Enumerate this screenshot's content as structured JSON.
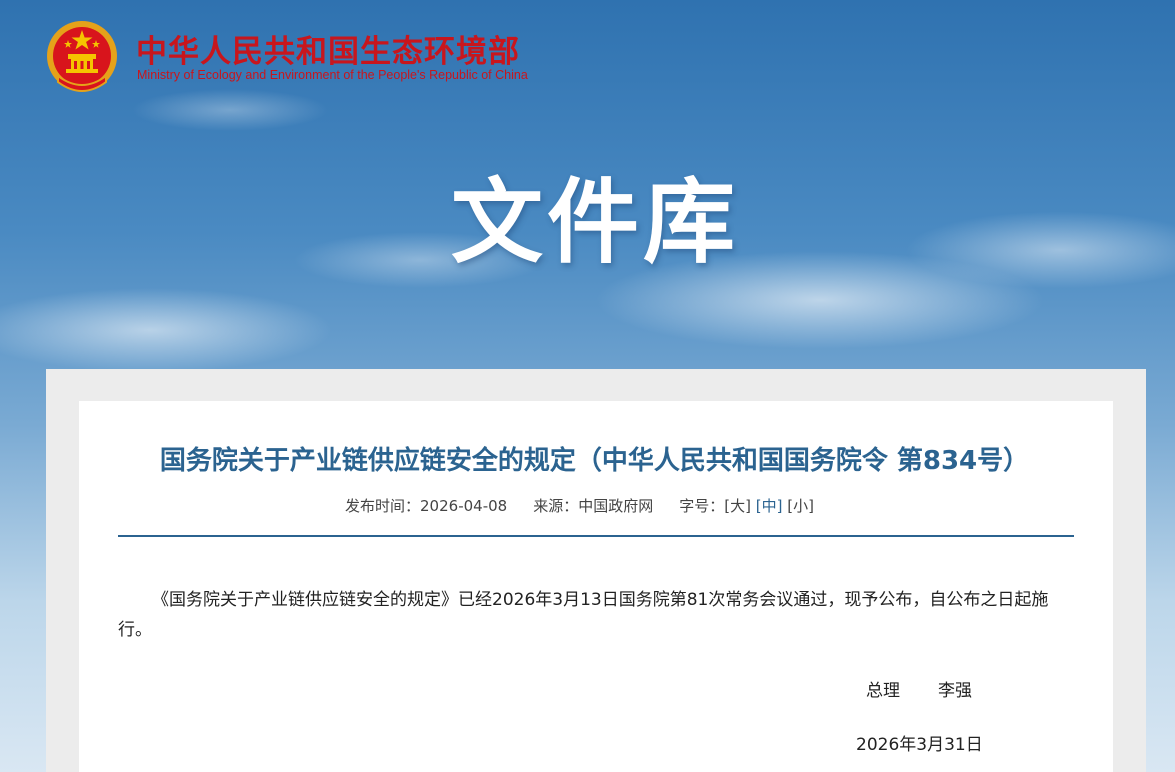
{
  "header": {
    "brand_cn": "中华人民共和国生态环境部",
    "brand_en": "Ministry of Ecology and Environment of the People's Republic of China",
    "hero_title": "文件库",
    "emblem_icon": "national-emblem-icon"
  },
  "article": {
    "title": "国务院关于产业链供应链安全的规定（中华人民共和国国务院令 第834号）",
    "meta": {
      "published_label": "发布时间：",
      "published_value": "2026-04-08",
      "source_label": "来源：",
      "source_value": "中国政府网",
      "font_size_label": "字号：",
      "size_large": "[大]",
      "size_medium": "[中]",
      "size_small": "[小]"
    },
    "body": "《国务院关于产业链供应链安全的规定》已经2026年3月13日国务院第81次常务会议通过，现予公布，自公布之日起施行。",
    "signature_title": "总理",
    "signature_name": "李强",
    "signature_date": "2026年3月31日"
  },
  "colors": {
    "brand_red": "#c8161d",
    "title_blue": "#2b6390",
    "sky_top": "#2f72b0"
  }
}
